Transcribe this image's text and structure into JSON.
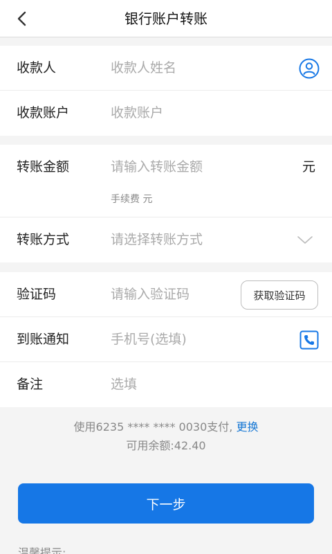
{
  "header": {
    "title": "银行账户转账",
    "back_icon": "chevron-left-icon"
  },
  "payee_group": {
    "payee": {
      "label": "收款人",
      "placeholder": "收款人姓名",
      "icon": "contact-person-icon"
    },
    "account": {
      "label": "收款账户",
      "placeholder": "收款账户"
    }
  },
  "amount_group": {
    "amount": {
      "label": "转账金额",
      "placeholder": "请输入转账金额",
      "unit": "元",
      "fee_text": "手续费 元"
    },
    "method": {
      "label": "转账方式",
      "placeholder": "请选择转账方式",
      "icon": "chevron-down-icon"
    }
  },
  "verify_group": {
    "code": {
      "label": "验证码",
      "placeholder": "请输入验证码",
      "button_label": "获取验证码"
    },
    "notify": {
      "label": "到账通知",
      "placeholder": "手机号(选填)",
      "icon": "phone-icon"
    },
    "remark": {
      "label": "备注",
      "placeholder": "选填"
    }
  },
  "payment": {
    "using_text": "使用6235 **** **** 0030支付,",
    "change_link": "更换",
    "balance_text": "可用余额:42.40"
  },
  "next_button": "下一步",
  "tips_title": "温馨提示:",
  "colors": {
    "accent": "#1677e6",
    "link": "#1677d4"
  }
}
